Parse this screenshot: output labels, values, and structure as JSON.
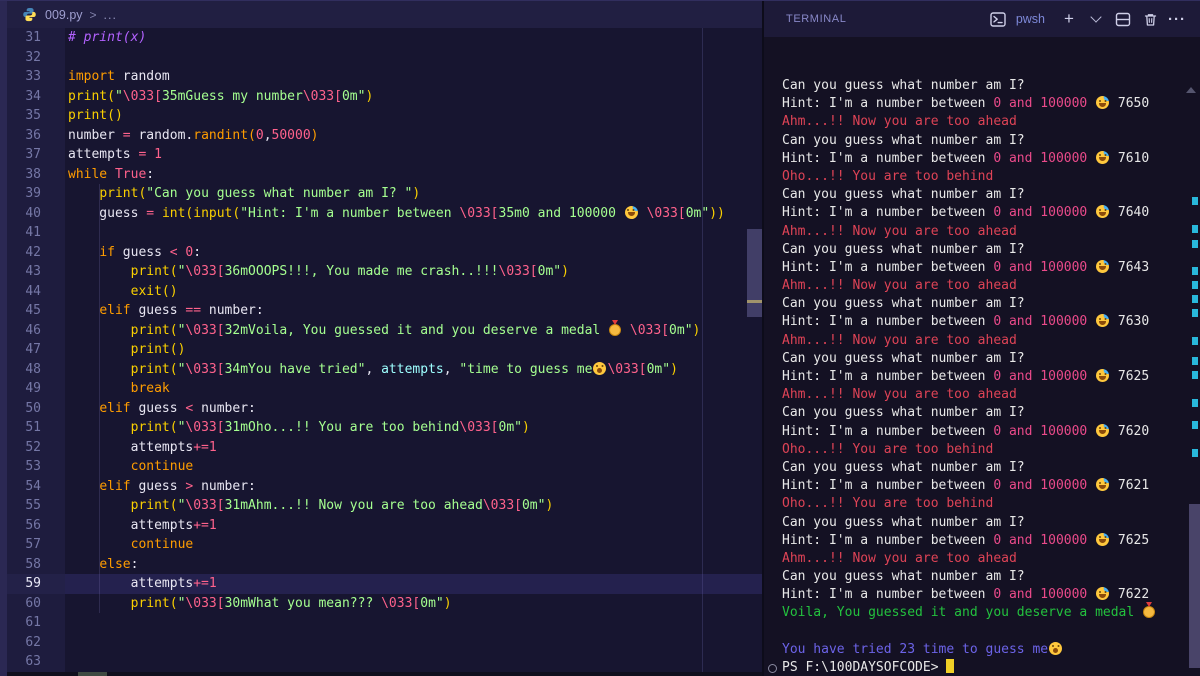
{
  "palette": {
    "editor_bg": "#171530",
    "gutter_bg": "#1e1c3e",
    "terminal_bg": "#141123",
    "keyword": "#ff9d00",
    "function": "#fad000",
    "string": "#a5ff90",
    "escape_and_number": "#ff628c",
    "comment": "#b362ff",
    "param": "#9effff",
    "ansi_red": "#de4356",
    "ansi_magenta": "#ea4a8a",
    "ansi_green": "#23c13e",
    "ansi_blue": "#6c63e8",
    "cursor": "#f0cf26",
    "scroll_mark": "#29b8db"
  },
  "editor": {
    "breadcrumb": {
      "file": "009.py",
      "sep": ">",
      "more": "..."
    },
    "lines": [
      {
        "n": "31",
        "segs": [
          [
            "cm",
            "# print(x)"
          ]
        ]
      },
      {
        "n": "32",
        "segs": []
      },
      {
        "n": "33",
        "segs": [
          [
            "kw",
            "import"
          ],
          [
            "pl",
            " random"
          ]
        ]
      },
      {
        "n": "34",
        "segs": [
          [
            "fn",
            "print("
          ],
          [
            "st",
            "\""
          ],
          [
            "es",
            "\\033["
          ],
          [
            "st",
            "35mGuess my number"
          ],
          [
            "es",
            "\\033["
          ],
          [
            "st",
            "0m\""
          ],
          [
            "fn",
            ")"
          ]
        ]
      },
      {
        "n": "35",
        "segs": [
          [
            "fn",
            "print()"
          ]
        ]
      },
      {
        "n": "36",
        "segs": [
          [
            "pl",
            "number "
          ],
          [
            "nu",
            "="
          ],
          [
            "pl",
            " random."
          ],
          [
            "fo",
            "randint("
          ],
          [
            "nu",
            "0"
          ],
          [
            "pl",
            ","
          ],
          [
            "nu",
            "50000"
          ],
          [
            "fo",
            ")"
          ]
        ]
      },
      {
        "n": "37",
        "segs": [
          [
            "pl",
            "attempts "
          ],
          [
            "nu",
            "="
          ],
          [
            "pl",
            " "
          ],
          [
            "nu",
            "1"
          ]
        ]
      },
      {
        "n": "38",
        "segs": [
          [
            "kw",
            "while "
          ],
          [
            "nu",
            "True"
          ],
          [
            "pl",
            ":"
          ]
        ]
      },
      {
        "n": "39",
        "segs": [
          [
            "pl",
            "    "
          ],
          [
            "fn",
            "print("
          ],
          [
            "st",
            "\"Can you guess what number am I? \""
          ],
          [
            "fn",
            ")"
          ]
        ]
      },
      {
        "n": "40",
        "segs": [
          [
            "pl",
            "    guess "
          ],
          [
            "nu",
            "="
          ],
          [
            "pl",
            " "
          ],
          [
            "fn",
            "int("
          ],
          [
            "fn",
            "input("
          ],
          [
            "st",
            "\"Hint: I'm a number between "
          ],
          [
            "es",
            "\\033["
          ],
          [
            "st",
            "35m0 and 100000 "
          ],
          [
            "e",
            "sweat"
          ],
          [
            "st",
            " "
          ],
          [
            "es",
            "\\033["
          ],
          [
            "st",
            "0m\""
          ],
          [
            "fn",
            "))"
          ]
        ]
      },
      {
        "n": "41",
        "segs": []
      },
      {
        "n": "42",
        "segs": [
          [
            "pl",
            "    "
          ],
          [
            "kw",
            "if"
          ],
          [
            "pl",
            " guess "
          ],
          [
            "nu",
            "<"
          ],
          [
            "pl",
            " "
          ],
          [
            "nu",
            "0"
          ],
          [
            "pl",
            ":"
          ]
        ]
      },
      {
        "n": "43",
        "segs": [
          [
            "pl",
            "        "
          ],
          [
            "fn",
            "print("
          ],
          [
            "st",
            "\""
          ],
          [
            "es",
            "\\033["
          ],
          [
            "st",
            "36mOOOPS!!!, You made me crash..!!!"
          ],
          [
            "es",
            "\\033["
          ],
          [
            "st",
            "0m\""
          ],
          [
            "fn",
            ")"
          ]
        ]
      },
      {
        "n": "44",
        "segs": [
          [
            "pl",
            "        "
          ],
          [
            "fn",
            "exit()"
          ]
        ]
      },
      {
        "n": "45",
        "segs": [
          [
            "pl",
            "    "
          ],
          [
            "kw",
            "elif"
          ],
          [
            "pl",
            " guess "
          ],
          [
            "nu",
            "=="
          ],
          [
            "pl",
            " number:"
          ]
        ]
      },
      {
        "n": "46",
        "segs": [
          [
            "pl",
            "        "
          ],
          [
            "fn",
            "print("
          ],
          [
            "st",
            "\""
          ],
          [
            "es",
            "\\033["
          ],
          [
            "st",
            "32mVoila, You guessed it and you deserve a medal "
          ],
          [
            "e",
            "medal"
          ],
          [
            "st",
            " "
          ],
          [
            "es",
            "\\033["
          ],
          [
            "st",
            "0m\""
          ],
          [
            "fn",
            ")"
          ]
        ]
      },
      {
        "n": "47",
        "segs": [
          [
            "pl",
            "        "
          ],
          [
            "fn",
            "print()"
          ]
        ]
      },
      {
        "n": "48",
        "segs": [
          [
            "pl",
            "        "
          ],
          [
            "fn",
            "print("
          ],
          [
            "st",
            "\""
          ],
          [
            "es",
            "\\033["
          ],
          [
            "st",
            "34mYou have tried\""
          ],
          [
            "pl",
            ", "
          ],
          [
            "pa",
            "attempts"
          ],
          [
            "pl",
            ", "
          ],
          [
            "st",
            "\"time to guess me"
          ],
          [
            "e",
            "shock"
          ],
          [
            "es",
            "\\033["
          ],
          [
            "st",
            "0m\""
          ],
          [
            "fn",
            ")"
          ]
        ]
      },
      {
        "n": "49",
        "segs": [
          [
            "pl",
            "        "
          ],
          [
            "kw",
            "break"
          ]
        ]
      },
      {
        "n": "50",
        "segs": [
          [
            "pl",
            "    "
          ],
          [
            "kw",
            "elif"
          ],
          [
            "pl",
            " guess "
          ],
          [
            "nu",
            "<"
          ],
          [
            "pl",
            " number:"
          ]
        ]
      },
      {
        "n": "51",
        "segs": [
          [
            "pl",
            "        "
          ],
          [
            "fn",
            "print("
          ],
          [
            "st",
            "\""
          ],
          [
            "es",
            "\\033["
          ],
          [
            "st",
            "31mOho...!! You are too behind"
          ],
          [
            "es",
            "\\033["
          ],
          [
            "st",
            "0m\""
          ],
          [
            "fn",
            ")"
          ]
        ]
      },
      {
        "n": "52",
        "segs": [
          [
            "pl",
            "        attempts"
          ],
          [
            "nu",
            "+="
          ],
          [
            "nu",
            "1"
          ]
        ]
      },
      {
        "n": "53",
        "segs": [
          [
            "pl",
            "        "
          ],
          [
            "kw",
            "continue"
          ]
        ]
      },
      {
        "n": "54",
        "segs": [
          [
            "pl",
            "    "
          ],
          [
            "kw",
            "elif"
          ],
          [
            "pl",
            " guess "
          ],
          [
            "nu",
            ">"
          ],
          [
            "pl",
            " number:"
          ]
        ]
      },
      {
        "n": "55",
        "segs": [
          [
            "pl",
            "        "
          ],
          [
            "fn",
            "print("
          ],
          [
            "st",
            "\""
          ],
          [
            "es",
            "\\033["
          ],
          [
            "st",
            "31mAhm...!! Now you are too ahead"
          ],
          [
            "es",
            "\\033["
          ],
          [
            "st",
            "0m\""
          ],
          [
            "fn",
            ")"
          ]
        ]
      },
      {
        "n": "56",
        "segs": [
          [
            "pl",
            "        attempts"
          ],
          [
            "nu",
            "+="
          ],
          [
            "nu",
            "1"
          ]
        ]
      },
      {
        "n": "57",
        "segs": [
          [
            "pl",
            "        "
          ],
          [
            "kw",
            "continue"
          ]
        ]
      },
      {
        "n": "58",
        "segs": [
          [
            "pl",
            "    "
          ],
          [
            "kw",
            "else"
          ],
          [
            "pl",
            ":"
          ]
        ]
      },
      {
        "n": "59",
        "hl": true,
        "segs": [
          [
            "pl",
            "        attempts"
          ],
          [
            "nu",
            "+="
          ],
          [
            "nu",
            "1"
          ]
        ]
      },
      {
        "n": "60",
        "segs": [
          [
            "pl",
            "        "
          ],
          [
            "fn",
            "print("
          ],
          [
            "st",
            "\""
          ],
          [
            "es",
            "\\033["
          ],
          [
            "st",
            "30mWhat you mean??? "
          ],
          [
            "es",
            "\\033["
          ],
          [
            "st",
            "0m\""
          ],
          [
            "fn",
            ")"
          ]
        ]
      },
      {
        "n": "61",
        "segs": []
      },
      {
        "n": "62",
        "segs": []
      },
      {
        "n": "63",
        "segs": []
      }
    ]
  },
  "terminal": {
    "header": {
      "title": "TERMINAL",
      "shell": "pwsh",
      "plus_glyph": "+",
      "more_glyph": "···"
    },
    "lines": [
      {
        "segs": [
          [
            "w",
            "Can you guess what number am I? "
          ]
        ]
      },
      {
        "segs": [
          [
            "w",
            "Hint: I'm a number between "
          ],
          [
            "m",
            "0 and 100000"
          ],
          [
            "w",
            " "
          ],
          [
            "e",
            "sweat"
          ],
          [
            "w",
            " 7650"
          ]
        ]
      },
      {
        "segs": [
          [
            "r",
            "Ahm...!! Now you are too ahead"
          ]
        ]
      },
      {
        "segs": [
          [
            "w",
            "Can you guess what number am I? "
          ]
        ]
      },
      {
        "segs": [
          [
            "w",
            "Hint: I'm a number between "
          ],
          [
            "m",
            "0 and 100000"
          ],
          [
            "w",
            " "
          ],
          [
            "e",
            "sweat"
          ],
          [
            "w",
            " 7610"
          ]
        ]
      },
      {
        "segs": [
          [
            "r",
            "Oho...!! You are too behind"
          ]
        ]
      },
      {
        "segs": [
          [
            "w",
            "Can you guess what number am I? "
          ]
        ]
      },
      {
        "segs": [
          [
            "w",
            "Hint: I'm a number between "
          ],
          [
            "m",
            "0 and 100000"
          ],
          [
            "w",
            " "
          ],
          [
            "e",
            "sweat"
          ],
          [
            "w",
            " 7640"
          ]
        ]
      },
      {
        "segs": [
          [
            "r",
            "Ahm...!! Now you are too ahead"
          ]
        ]
      },
      {
        "segs": [
          [
            "w",
            "Can you guess what number am I? "
          ]
        ]
      },
      {
        "segs": [
          [
            "w",
            "Hint: I'm a number between "
          ],
          [
            "m",
            "0 and 100000"
          ],
          [
            "w",
            " "
          ],
          [
            "e",
            "sweat"
          ],
          [
            "w",
            " 7643"
          ]
        ]
      },
      {
        "segs": [
          [
            "r",
            "Ahm...!! Now you are too ahead"
          ]
        ]
      },
      {
        "segs": [
          [
            "w",
            "Can you guess what number am I? "
          ]
        ]
      },
      {
        "segs": [
          [
            "w",
            "Hint: I'm a number between "
          ],
          [
            "m",
            "0 and 100000"
          ],
          [
            "w",
            " "
          ],
          [
            "e",
            "sweat"
          ],
          [
            "w",
            " 7630"
          ]
        ]
      },
      {
        "segs": [
          [
            "r",
            "Ahm...!! Now you are too ahead"
          ]
        ]
      },
      {
        "segs": [
          [
            "w",
            "Can you guess what number am I? "
          ]
        ]
      },
      {
        "segs": [
          [
            "w",
            "Hint: I'm a number between "
          ],
          [
            "m",
            "0 and 100000"
          ],
          [
            "w",
            " "
          ],
          [
            "e",
            "sweat"
          ],
          [
            "w",
            " 7625"
          ]
        ]
      },
      {
        "segs": [
          [
            "r",
            "Ahm...!! Now you are too ahead"
          ]
        ]
      },
      {
        "segs": [
          [
            "w",
            "Can you guess what number am I? "
          ]
        ]
      },
      {
        "segs": [
          [
            "w",
            "Hint: I'm a number between "
          ],
          [
            "m",
            "0 and 100000"
          ],
          [
            "w",
            " "
          ],
          [
            "e",
            "sweat"
          ],
          [
            "w",
            " 7620"
          ]
        ]
      },
      {
        "segs": [
          [
            "r",
            "Oho...!! You are too behind"
          ]
        ]
      },
      {
        "segs": [
          [
            "w",
            "Can you guess what number am I? "
          ]
        ]
      },
      {
        "segs": [
          [
            "w",
            "Hint: I'm a number between "
          ],
          [
            "m",
            "0 and 100000"
          ],
          [
            "w",
            " "
          ],
          [
            "e",
            "sweat"
          ],
          [
            "w",
            " 7621"
          ]
        ]
      },
      {
        "segs": [
          [
            "r",
            "Oho...!! You are too behind"
          ]
        ]
      },
      {
        "segs": [
          [
            "w",
            "Can you guess what number am I? "
          ]
        ]
      },
      {
        "segs": [
          [
            "w",
            "Hint: I'm a number between "
          ],
          [
            "m",
            "0 and 100000"
          ],
          [
            "w",
            " "
          ],
          [
            "e",
            "sweat"
          ],
          [
            "w",
            " 7625"
          ]
        ]
      },
      {
        "segs": [
          [
            "r",
            "Ahm...!! Now you are too ahead"
          ]
        ]
      },
      {
        "segs": [
          [
            "w",
            "Can you guess what number am I? "
          ]
        ]
      },
      {
        "segs": [
          [
            "w",
            "Hint: I'm a number between "
          ],
          [
            "m",
            "0 and 100000"
          ],
          [
            "w",
            " "
          ],
          [
            "e",
            "sweat"
          ],
          [
            "w",
            " 7622"
          ]
        ]
      },
      {
        "segs": [
          [
            "g",
            "Voila, You guessed it and you deserve a medal "
          ],
          [
            "e",
            "medal"
          ]
        ]
      },
      {
        "segs": []
      },
      {
        "segs": [
          [
            "b",
            "You have tried 23 time to guess me"
          ],
          [
            "e",
            "shock"
          ]
        ]
      },
      {
        "deco": true,
        "cursor": true,
        "segs": [
          [
            "w",
            "PS F:\\100DAYSOFCODE> "
          ]
        ]
      }
    ]
  }
}
